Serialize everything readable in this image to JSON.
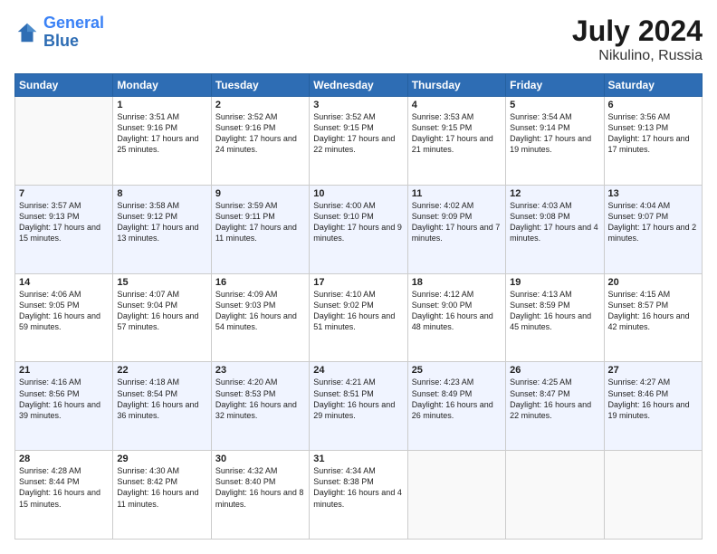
{
  "header": {
    "logo_line1": "General",
    "logo_line2": "Blue",
    "month_year": "July 2024",
    "location": "Nikulino, Russia"
  },
  "days_of_week": [
    "Sunday",
    "Monday",
    "Tuesday",
    "Wednesday",
    "Thursday",
    "Friday",
    "Saturday"
  ],
  "weeks": [
    [
      {
        "day": "",
        "info": ""
      },
      {
        "day": "1",
        "info": "Sunrise: 3:51 AM\nSunset: 9:16 PM\nDaylight: 17 hours\nand 25 minutes."
      },
      {
        "day": "2",
        "info": "Sunrise: 3:52 AM\nSunset: 9:16 PM\nDaylight: 17 hours\nand 24 minutes."
      },
      {
        "day": "3",
        "info": "Sunrise: 3:52 AM\nSunset: 9:15 PM\nDaylight: 17 hours\nand 22 minutes."
      },
      {
        "day": "4",
        "info": "Sunrise: 3:53 AM\nSunset: 9:15 PM\nDaylight: 17 hours\nand 21 minutes."
      },
      {
        "day": "5",
        "info": "Sunrise: 3:54 AM\nSunset: 9:14 PM\nDaylight: 17 hours\nand 19 minutes."
      },
      {
        "day": "6",
        "info": "Sunrise: 3:56 AM\nSunset: 9:13 PM\nDaylight: 17 hours\nand 17 minutes."
      }
    ],
    [
      {
        "day": "7",
        "info": "Sunrise: 3:57 AM\nSunset: 9:13 PM\nDaylight: 17 hours\nand 15 minutes."
      },
      {
        "day": "8",
        "info": "Sunrise: 3:58 AM\nSunset: 9:12 PM\nDaylight: 17 hours\nand 13 minutes."
      },
      {
        "day": "9",
        "info": "Sunrise: 3:59 AM\nSunset: 9:11 PM\nDaylight: 17 hours\nand 11 minutes."
      },
      {
        "day": "10",
        "info": "Sunrise: 4:00 AM\nSunset: 9:10 PM\nDaylight: 17 hours\nand 9 minutes."
      },
      {
        "day": "11",
        "info": "Sunrise: 4:02 AM\nSunset: 9:09 PM\nDaylight: 17 hours\nand 7 minutes."
      },
      {
        "day": "12",
        "info": "Sunrise: 4:03 AM\nSunset: 9:08 PM\nDaylight: 17 hours\nand 4 minutes."
      },
      {
        "day": "13",
        "info": "Sunrise: 4:04 AM\nSunset: 9:07 PM\nDaylight: 17 hours\nand 2 minutes."
      }
    ],
    [
      {
        "day": "14",
        "info": "Sunrise: 4:06 AM\nSunset: 9:05 PM\nDaylight: 16 hours\nand 59 minutes."
      },
      {
        "day": "15",
        "info": "Sunrise: 4:07 AM\nSunset: 9:04 PM\nDaylight: 16 hours\nand 57 minutes."
      },
      {
        "day": "16",
        "info": "Sunrise: 4:09 AM\nSunset: 9:03 PM\nDaylight: 16 hours\nand 54 minutes."
      },
      {
        "day": "17",
        "info": "Sunrise: 4:10 AM\nSunset: 9:02 PM\nDaylight: 16 hours\nand 51 minutes."
      },
      {
        "day": "18",
        "info": "Sunrise: 4:12 AM\nSunset: 9:00 PM\nDaylight: 16 hours\nand 48 minutes."
      },
      {
        "day": "19",
        "info": "Sunrise: 4:13 AM\nSunset: 8:59 PM\nDaylight: 16 hours\nand 45 minutes."
      },
      {
        "day": "20",
        "info": "Sunrise: 4:15 AM\nSunset: 8:57 PM\nDaylight: 16 hours\nand 42 minutes."
      }
    ],
    [
      {
        "day": "21",
        "info": "Sunrise: 4:16 AM\nSunset: 8:56 PM\nDaylight: 16 hours\nand 39 minutes."
      },
      {
        "day": "22",
        "info": "Sunrise: 4:18 AM\nSunset: 8:54 PM\nDaylight: 16 hours\nand 36 minutes."
      },
      {
        "day": "23",
        "info": "Sunrise: 4:20 AM\nSunset: 8:53 PM\nDaylight: 16 hours\nand 32 minutes."
      },
      {
        "day": "24",
        "info": "Sunrise: 4:21 AM\nSunset: 8:51 PM\nDaylight: 16 hours\nand 29 minutes."
      },
      {
        "day": "25",
        "info": "Sunrise: 4:23 AM\nSunset: 8:49 PM\nDaylight: 16 hours\nand 26 minutes."
      },
      {
        "day": "26",
        "info": "Sunrise: 4:25 AM\nSunset: 8:47 PM\nDaylight: 16 hours\nand 22 minutes."
      },
      {
        "day": "27",
        "info": "Sunrise: 4:27 AM\nSunset: 8:46 PM\nDaylight: 16 hours\nand 19 minutes."
      }
    ],
    [
      {
        "day": "28",
        "info": "Sunrise: 4:28 AM\nSunset: 8:44 PM\nDaylight: 16 hours\nand 15 minutes."
      },
      {
        "day": "29",
        "info": "Sunrise: 4:30 AM\nSunset: 8:42 PM\nDaylight: 16 hours\nand 11 minutes."
      },
      {
        "day": "30",
        "info": "Sunrise: 4:32 AM\nSunset: 8:40 PM\nDaylight: 16 hours\nand 8 minutes."
      },
      {
        "day": "31",
        "info": "Sunrise: 4:34 AM\nSunset: 8:38 PM\nDaylight: 16 hours\nand 4 minutes."
      },
      {
        "day": "",
        "info": ""
      },
      {
        "day": "",
        "info": ""
      },
      {
        "day": "",
        "info": ""
      }
    ]
  ]
}
